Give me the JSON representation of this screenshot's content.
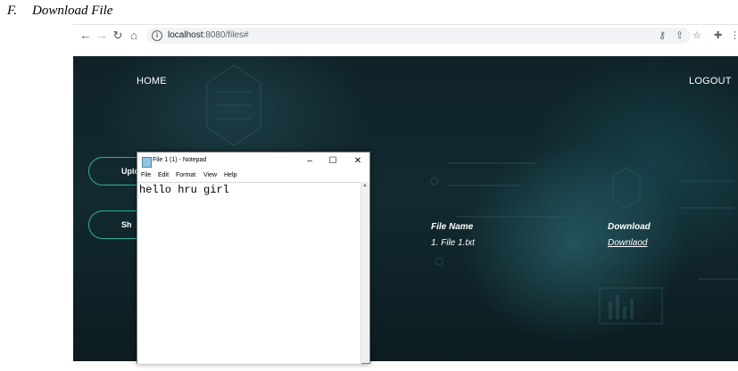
{
  "caption": {
    "letter": "F.",
    "text": "Download File"
  },
  "browser": {
    "url_host": "localhost",
    "url_path": ":8080/files#",
    "icons": [
      "back-icon",
      "forward-icon",
      "reload-icon",
      "home-icon",
      "info-icon",
      "key-icon",
      "share-icon",
      "star-icon",
      "extensions-icon",
      "menu-icon"
    ]
  },
  "site": {
    "nav": {
      "home": "HOME",
      "logout": "LOGOUT"
    },
    "side_buttons": [
      {
        "label": "Uplo"
      },
      {
        "label": "Sh"
      }
    ],
    "table": {
      "headers": [
        "File Name",
        "Download"
      ],
      "rows": [
        {
          "file": "1. File 1.txt",
          "download": "Downlaod"
        }
      ]
    },
    "accent_color": "#2bb39a"
  },
  "notepad": {
    "title": "File 1 (1) - Notepad",
    "menu": [
      "File",
      "Edit",
      "Format",
      "View",
      "Help"
    ],
    "content": "hello hru girl",
    "window_controls": {
      "minimize": "–",
      "maximize": "☐",
      "close": "✕"
    }
  }
}
